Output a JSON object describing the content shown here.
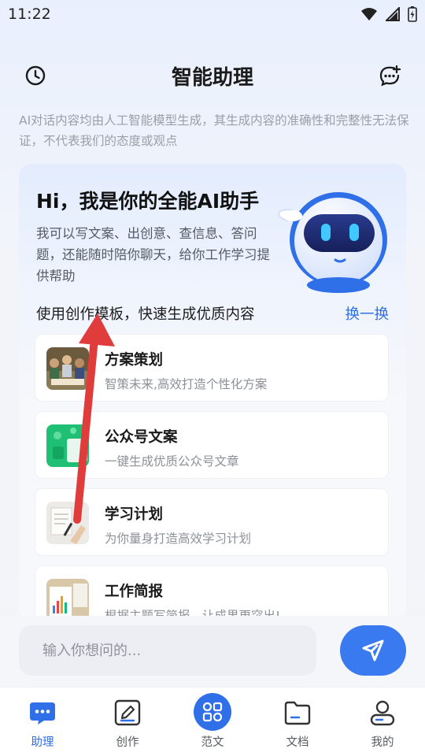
{
  "status_bar": {
    "time": "11:22"
  },
  "header": {
    "title": "智能助理"
  },
  "disclaimer": "AI对话内容均由人工智能模型生成，其生成内容的准确性和完整性无法保证，不代表我们的态度或观点",
  "intro": {
    "title": "Hi，我是你的全能AI助手",
    "description": "我可以写文案、出创意、查信息、答问题，还能随时陪你聊天，给你工作学习提供帮助"
  },
  "templates": {
    "label": "使用创作模板，快速生成优质内容",
    "swap_label": "换一换",
    "items": [
      {
        "title": "方案策划",
        "subtitle": "智策未来,高效打造个性化方案"
      },
      {
        "title": "公众号文案",
        "subtitle": "一键生成优质公众号文章"
      },
      {
        "title": "学习计划",
        "subtitle": "为你量身打造高效学习计划"
      },
      {
        "title": "工作简报",
        "subtitle": "根据主题写简报，让成果更突出!"
      }
    ]
  },
  "input": {
    "placeholder": "输入你想问的..."
  },
  "bottom_nav": {
    "items": [
      {
        "label": "助理",
        "icon": "chat-icon",
        "active": true
      },
      {
        "label": "创作",
        "icon": "pen-edit-icon",
        "active": false
      },
      {
        "label": "范文",
        "icon": "grid-icon",
        "active": false
      },
      {
        "label": "文档",
        "icon": "folder-icon",
        "active": false
      },
      {
        "label": "我的",
        "icon": "user-icon",
        "active": false
      }
    ]
  },
  "colors": {
    "accent": "#2f6fe8",
    "send_button": "#3a7af0",
    "annotation_arrow": "#e03c3c"
  }
}
